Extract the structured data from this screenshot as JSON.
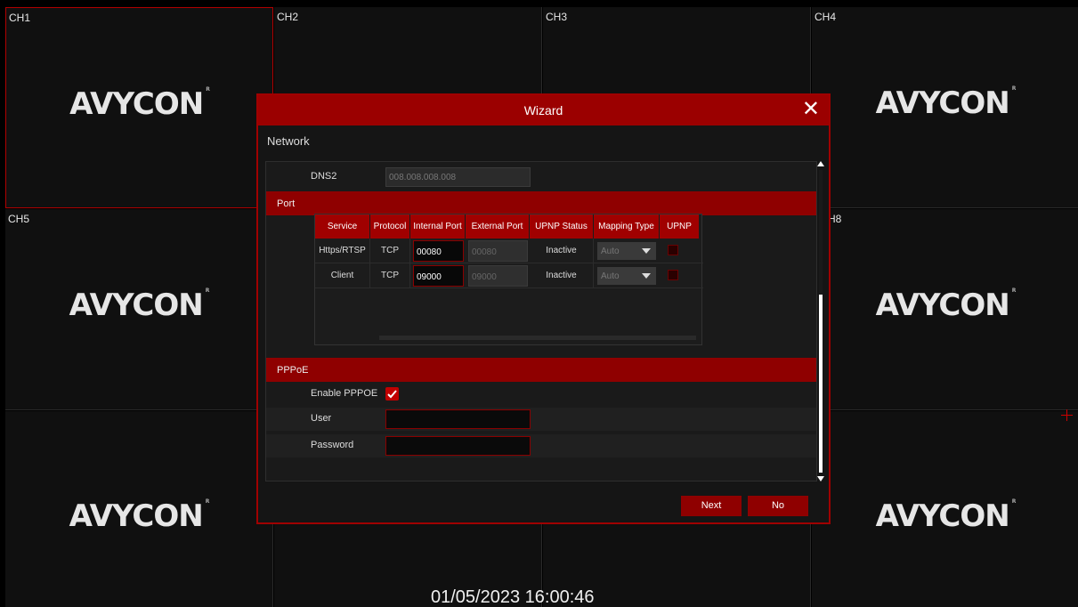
{
  "channels": [
    {
      "label": "CH1",
      "logo": "AVYCON"
    },
    {
      "label": "CH2",
      "logo": ""
    },
    {
      "label": "CH3",
      "logo": ""
    },
    {
      "label": "CH4",
      "logo": "AVYCON"
    },
    {
      "label": "CH5",
      "logo": "AVYCON"
    },
    {
      "label": "",
      "logo": ""
    },
    {
      "label": "",
      "logo": ""
    },
    {
      "label": "H8",
      "logo": "AVYCON"
    },
    {
      "label": "",
      "logo": "AVYCON"
    },
    {
      "label": "",
      "logo": ""
    },
    {
      "label": "",
      "logo": ""
    },
    {
      "label": "",
      "logo": "AVYCON"
    }
  ],
  "logo_mark": "R",
  "timestamp": "01/05/2023 16:00:46",
  "dialog": {
    "title": "Wizard",
    "close_glyph": "✕",
    "section": "Network",
    "dns2": {
      "label": "DNS2",
      "value": "008.008.008.008"
    },
    "port": {
      "band_label": "Port",
      "headers": [
        "Service",
        "Protocol",
        "Internal Port",
        "External Port",
        "UPNP Status",
        "Mapping Type",
        "UPNP"
      ],
      "rows": [
        {
          "service": "Https/RTSP",
          "protocol": "TCP",
          "internal": "00080",
          "external": "00080",
          "status": "Inactive",
          "mapping": "Auto"
        },
        {
          "service": "Client",
          "protocol": "TCP",
          "internal": "09000",
          "external": "09000",
          "status": "Inactive",
          "mapping": "Auto"
        }
      ]
    },
    "pppoe": {
      "band_label": "PPPoE",
      "enable_label": "Enable PPPOE",
      "enabled": true,
      "user_label": "User",
      "user_value": "",
      "password_label": "Password",
      "password_value": ""
    },
    "buttons": {
      "next": "Next",
      "no": "No"
    }
  },
  "colors": {
    "accent": "#9b0000",
    "background": "#101010"
  }
}
